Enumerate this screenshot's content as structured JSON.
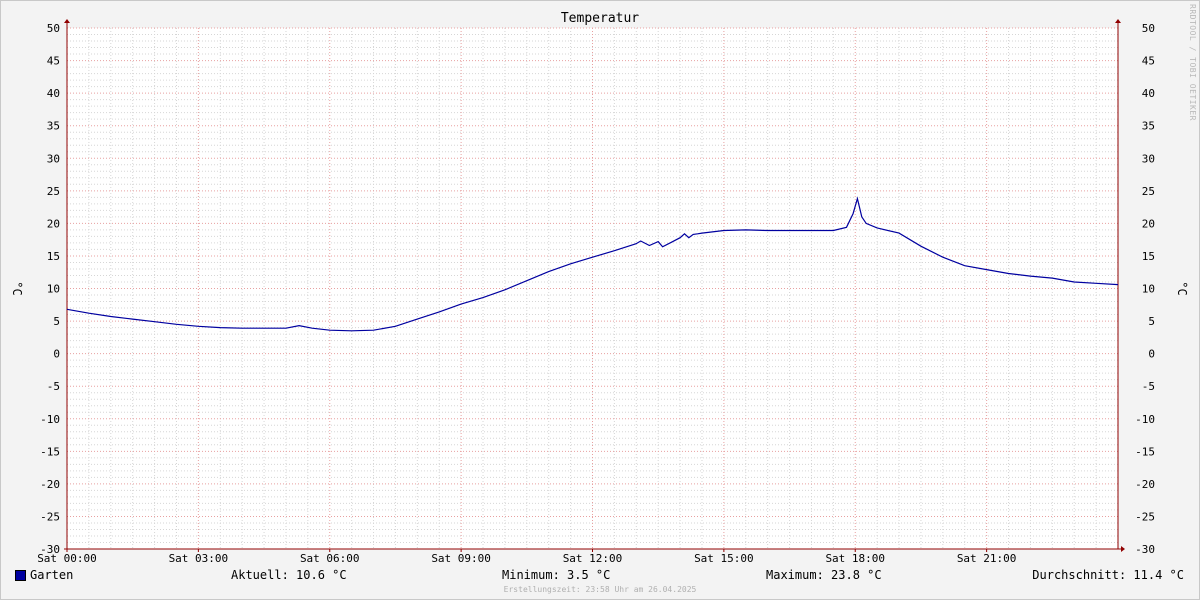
{
  "chart_data": {
    "type": "line",
    "title": "Temperatur",
    "ylabel": "°C",
    "ylim": [
      -30,
      50
    ],
    "y_ticks": [
      50,
      45,
      40,
      35,
      30,
      25,
      20,
      15,
      10,
      5,
      0,
      -5,
      -10,
      -15,
      -20,
      -25,
      -30
    ],
    "x_hour_range": [
      0,
      24
    ],
    "x_ticks": [
      "Sat 00:00",
      "Sat 03:00",
      "Sat 06:00",
      "Sat 09:00",
      "Sat 12:00",
      "Sat 15:00",
      "Sat 18:00",
      "Sat 21:00"
    ],
    "grid": true,
    "legend_position": "bottom-left",
    "colors": {
      "line": "#0000a0",
      "major_grid": "#e8a0a0",
      "minor_grid": "#d6d6d6",
      "axis": "#900000",
      "background": "#ffffff"
    },
    "series": [
      {
        "name": "Garten",
        "x_hours": [
          0,
          0.5,
          1,
          1.5,
          2,
          2.5,
          3,
          3.5,
          4,
          4.5,
          5,
          5.3,
          5.6,
          6,
          6.5,
          7,
          7.5,
          8,
          8.5,
          9,
          9.5,
          10,
          10.5,
          11,
          11.5,
          12,
          12.5,
          13,
          13.1,
          13.3,
          13.5,
          13.6,
          13.8,
          14,
          14.1,
          14.2,
          14.3,
          14.4,
          14.5,
          15,
          15.5,
          16,
          16.5,
          17,
          17.5,
          17.8,
          17.95,
          18.05,
          18.15,
          18.25,
          18.5,
          19,
          19.5,
          20,
          20.5,
          21,
          21.5,
          22,
          22.5,
          23,
          23.5,
          24
        ],
        "values": [
          6.8,
          6.2,
          5.7,
          5.3,
          4.9,
          4.5,
          4.2,
          4.0,
          3.9,
          3.9,
          3.9,
          4.3,
          3.9,
          3.6,
          3.5,
          3.6,
          4.2,
          5.3,
          6.4,
          7.6,
          8.6,
          9.8,
          11.2,
          12.6,
          13.8,
          14.8,
          15.8,
          16.9,
          17.3,
          16.6,
          17.2,
          16.4,
          17.1,
          17.8,
          18.4,
          17.8,
          18.3,
          18.4,
          18.5,
          18.9,
          19.0,
          18.9,
          18.9,
          18.9,
          18.9,
          19.4,
          21.5,
          23.8,
          21.0,
          20.0,
          19.3,
          18.5,
          16.5,
          14.8,
          13.5,
          12.9,
          12.3,
          11.9,
          11.6,
          11.0,
          10.8,
          10.6
        ]
      }
    ]
  },
  "legend": {
    "series_name": "Garten",
    "aktuell": "Aktuell: 10.6 °C",
    "minimum": "Minimum: 3.5 °C",
    "maximum": "Maximum: 23.8 °C",
    "durchschnitt": "Durchschnitt: 11.4 °C"
  },
  "footer": "Erstellungszeit: 23:58 Uhr am 26.04.2025",
  "watermark": "RRDTOOL / TOBI OETIKER"
}
